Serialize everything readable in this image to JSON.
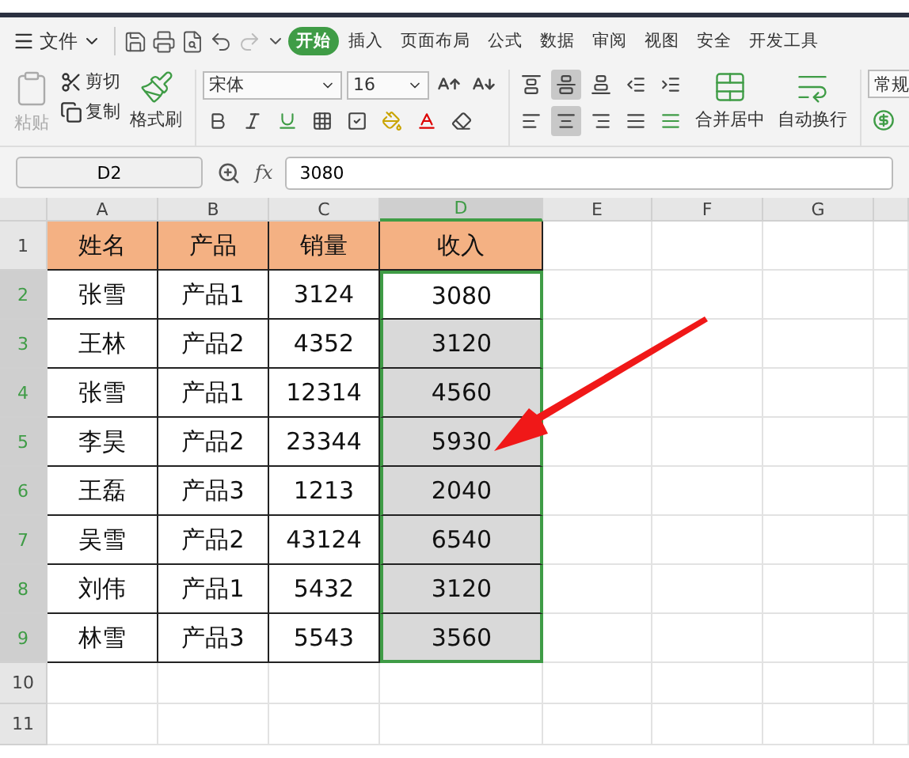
{
  "menu": {
    "file": "文件",
    "tabs": [
      {
        "label": "开始",
        "selected": true
      },
      {
        "label": "插入",
        "selected": false
      },
      {
        "label": "页面布局",
        "selected": false
      },
      {
        "label": "公式",
        "selected": false
      },
      {
        "label": "数据",
        "selected": false
      },
      {
        "label": "审阅",
        "selected": false
      },
      {
        "label": "视图",
        "selected": false
      },
      {
        "label": "安全",
        "selected": false
      },
      {
        "label": "开发工具",
        "selected": false
      }
    ]
  },
  "ribbon": {
    "paste": {
      "label": "粘贴",
      "disabled": true
    },
    "cut": "剪切",
    "copy": "复制",
    "format_painter": "格式刷",
    "font_name": "宋体",
    "font_size": "16",
    "merge": "合并居中",
    "wrap": "自动换行",
    "number_format": "常规"
  },
  "formula_bar": {
    "name_box": "D2",
    "fx_label": "fx",
    "formula": "3080"
  },
  "columns": [
    {
      "label": "A",
      "selected": false
    },
    {
      "label": "B",
      "selected": false
    },
    {
      "label": "C",
      "selected": false
    },
    {
      "label": "D",
      "selected": true
    },
    {
      "label": "E",
      "selected": false
    },
    {
      "label": "F",
      "selected": false
    },
    {
      "label": "G",
      "selected": false
    }
  ],
  "rows": [
    {
      "label": "1",
      "selected": false,
      "cells": [
        "姓名",
        "产品",
        "销量",
        "收入"
      ]
    },
    {
      "label": "2",
      "selected": true,
      "cells": [
        "张雪",
        "产品1",
        "3124",
        "3080"
      ]
    },
    {
      "label": "3",
      "selected": true,
      "cells": [
        "王林",
        "产品2",
        "4352",
        "3120"
      ]
    },
    {
      "label": "4",
      "selected": true,
      "cells": [
        "张雪",
        "产品1",
        "12314",
        "4560"
      ]
    },
    {
      "label": "5",
      "selected": true,
      "cells": [
        "李昊",
        "产品2",
        "23344",
        "5930"
      ]
    },
    {
      "label": "6",
      "selected": true,
      "cells": [
        "王磊",
        "产品3",
        "1213",
        "2040"
      ]
    },
    {
      "label": "7",
      "selected": true,
      "cells": [
        "吴雪",
        "产品2",
        "43124",
        "6540"
      ]
    },
    {
      "label": "8",
      "selected": true,
      "cells": [
        "刘伟",
        "产品1",
        "5432",
        "3120"
      ]
    },
    {
      "label": "9",
      "selected": true,
      "cells": [
        "林雪",
        "产品3",
        "5543",
        "3560"
      ]
    },
    {
      "label": "10",
      "selected": false,
      "cells": []
    },
    {
      "label": "11",
      "selected": false,
      "cells": []
    }
  ]
}
